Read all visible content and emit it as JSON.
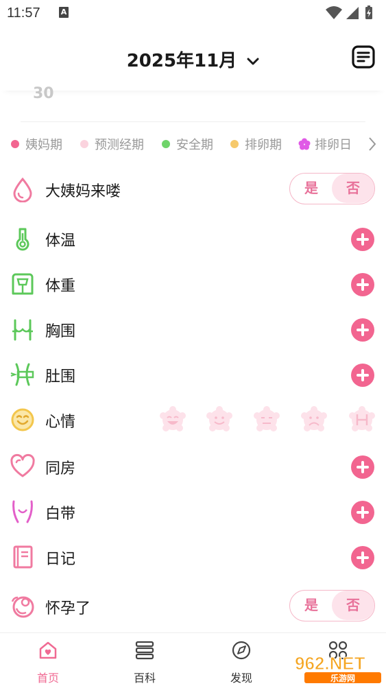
{
  "status_bar": {
    "time": "11:57",
    "notification_letter": "A"
  },
  "header": {
    "month": "2025年11月"
  },
  "calendar": {
    "partial_day": "30"
  },
  "legend": [
    {
      "label": "姨妈期",
      "color": "#f26590"
    },
    {
      "label": "预测经期",
      "color": "#fbd3de"
    },
    {
      "label": "安全期",
      "color": "#6fd46a"
    },
    {
      "label": "排卵期",
      "color": "#f6c96b"
    },
    {
      "label": "排卵日",
      "color": "#e05ae6",
      "shape": "flower"
    }
  ],
  "records": {
    "period": {
      "label": "大姨妈来喽",
      "yes": "是",
      "no": "否",
      "selected": "否"
    },
    "temperature": {
      "label": "体温"
    },
    "weight": {
      "label": "体重"
    },
    "bust": {
      "label": "胸围"
    },
    "waist": {
      "label": "肚围"
    },
    "mood": {
      "label": "心情",
      "faces": [
        "laughing",
        "smile",
        "neutral",
        "sad",
        "angry"
      ]
    },
    "intimacy": {
      "label": "同房"
    },
    "discharge": {
      "label": "白带"
    },
    "diary": {
      "label": "日记"
    },
    "pregnant": {
      "label": "怀孕了",
      "yes": "是",
      "no": "否",
      "selected": "否"
    }
  },
  "bottom_nav": {
    "home": "首页",
    "encyclopedia": "百科",
    "discover": "发现",
    "more": "更多"
  },
  "watermark": {
    "text": "962.NET",
    "subtext": "乐游网"
  },
  "colors": {
    "accent": "#f26590",
    "green_icon": "#5cc85a",
    "pink_icon": "#f07aa0"
  }
}
